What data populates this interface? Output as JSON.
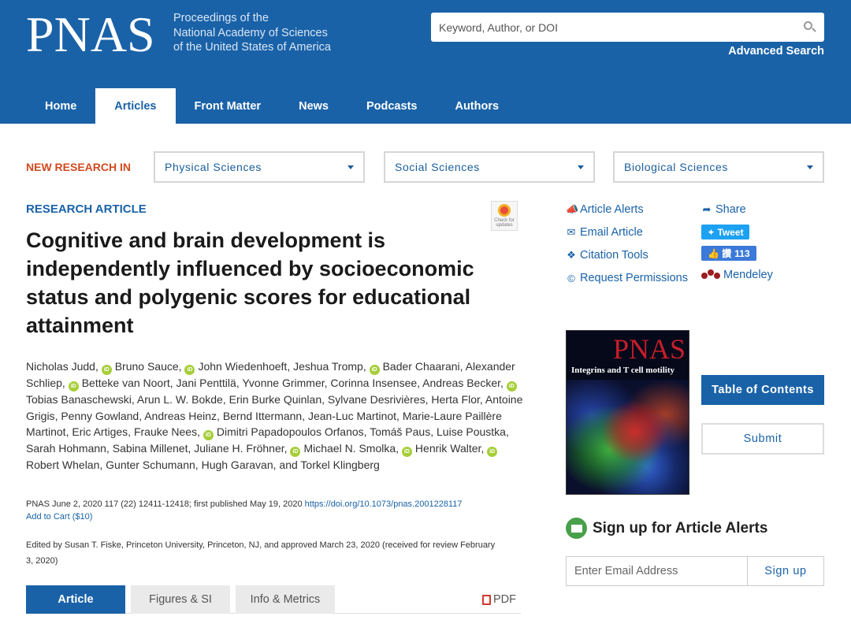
{
  "header": {
    "logo": "PNAS",
    "tagline": [
      "Proceedings of the",
      "National Academy of Sciences",
      "of the United States of America"
    ],
    "search_placeholder": "Keyword, Author, or DOI",
    "advanced_search": "Advanced Search",
    "colors": {
      "header_bg": "#1a62a8"
    }
  },
  "nav": {
    "tabs": [
      {
        "label": "Home",
        "active": false
      },
      {
        "label": "Articles",
        "active": true
      },
      {
        "label": "Front Matter",
        "active": false
      },
      {
        "label": "News",
        "active": false
      },
      {
        "label": "Podcasts",
        "active": false
      },
      {
        "label": "Authors",
        "active": false
      }
    ]
  },
  "new_research": {
    "label": "NEW RESEARCH IN",
    "dropdowns": [
      "Physical Sciences",
      "Social Sciences",
      "Biological Sciences"
    ]
  },
  "article": {
    "type": "RESEARCH ARTICLE",
    "check_updates": "Check for updates",
    "title": "Cognitive and brain development is independently influenced by socioeconomic status and polygenic scores for educational attainment",
    "authors": [
      {
        "name": "Nicholas Judd",
        "orcid": false
      },
      {
        "name": "Bruno Sauce",
        "orcid": true
      },
      {
        "name": "John Wiedenhoeft",
        "orcid": true
      },
      {
        "name": "Jeshua Tromp",
        "orcid": false
      },
      {
        "name": "Bader Chaarani",
        "orcid": true
      },
      {
        "name": "Alexander Schliep",
        "orcid": false
      },
      {
        "name": "Betteke van Noort",
        "orcid": true
      },
      {
        "name": "Jani Penttilä",
        "orcid": false
      },
      {
        "name": "Yvonne Grimmer",
        "orcid": false
      },
      {
        "name": "Corinna Insensee",
        "orcid": false
      },
      {
        "name": "Andreas Becker",
        "orcid": false
      },
      {
        "name": "Tobias Banaschewski",
        "orcid": true
      },
      {
        "name": "Arun L. W. Bokde",
        "orcid": false
      },
      {
        "name": "Erin Burke Quinlan",
        "orcid": false
      },
      {
        "name": "Sylvane Desrivières",
        "orcid": false
      },
      {
        "name": "Herta Flor",
        "orcid": false
      },
      {
        "name": "Antoine Grigis",
        "orcid": false
      },
      {
        "name": "Penny Gowland",
        "orcid": false
      },
      {
        "name": "Andreas Heinz",
        "orcid": false
      },
      {
        "name": "Bernd Ittermann",
        "orcid": false
      },
      {
        "name": "Jean-Luc Martinot",
        "orcid": false
      },
      {
        "name": "Marie-Laure Paillère Martinot",
        "orcid": false
      },
      {
        "name": "Eric Artiges",
        "orcid": false
      },
      {
        "name": "Frauke Nees",
        "orcid": false
      },
      {
        "name": "Dimitri Papadopoulos Orfanos",
        "orcid": true
      },
      {
        "name": "Tomáš Paus",
        "orcid": false
      },
      {
        "name": "Luise Poustka",
        "orcid": false
      },
      {
        "name": "Sarah Hohmann",
        "orcid": false
      },
      {
        "name": "Sabina Millenet",
        "orcid": false
      },
      {
        "name": "Juliane H. Fröhner",
        "orcid": false
      },
      {
        "name": "Michael N. Smolka",
        "orcid": true
      },
      {
        "name": "Henrik Walter",
        "orcid": true
      },
      {
        "name": "Robert Whelan",
        "orcid": true
      },
      {
        "name": "Gunter Schumann",
        "orcid": false
      },
      {
        "name": "Hugh Garavan",
        "orcid": false
      },
      {
        "name": "Torkel Klingberg",
        "orcid": false
      }
    ],
    "citation_text": "PNAS June 2, 2020 117 (22) 12411-12418; first published May 19, 2020 ",
    "doi": "https://doi.org/10.1073/pnas.2001228117",
    "add_to_cart": "Add to Cart ($10)",
    "edited_by": "Edited by Susan T. Fiske, Princeton University, Princeton, NJ, and approved March 23, 2020 (received for review February 3, 2020)"
  },
  "article_tabs": {
    "tabs": [
      {
        "label": "Article",
        "active": true
      },
      {
        "label": "Figures & SI",
        "active": false
      },
      {
        "label": "Info & Metrics",
        "active": false
      }
    ],
    "pdf": "PDF"
  },
  "sidebar": {
    "tools": {
      "article_alerts": "Article Alerts",
      "email_article": "Email Article",
      "citation_tools": "Citation Tools",
      "request_permissions": "Request Permissions",
      "share": "Share",
      "tweet": "Tweet",
      "like_label": "讚",
      "like_count": "113",
      "mendeley": "Mendeley"
    },
    "cover": {
      "masthead": "PNAS",
      "headline": "Integrins and T cell motility"
    },
    "table_of_contents": "Table of Contents",
    "submit": "Submit",
    "signup": {
      "title": "Sign up for Article Alerts",
      "email_placeholder": "Enter Email Address",
      "button": "Sign up"
    }
  }
}
